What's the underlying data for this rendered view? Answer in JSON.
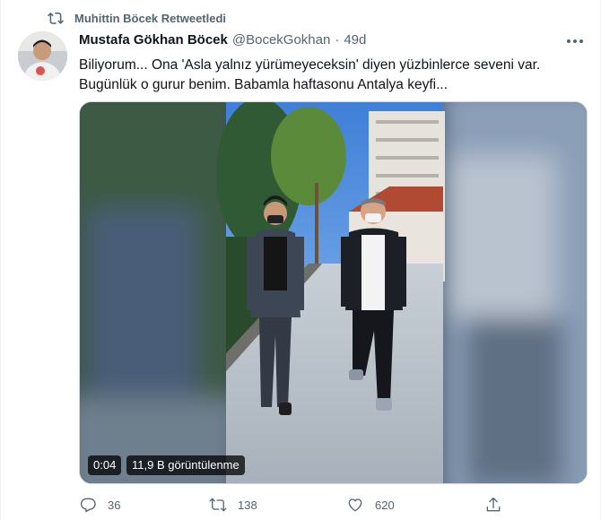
{
  "retweet": {
    "label": "Muhittin Böcek Retweetledi",
    "icon": "retweet-icon"
  },
  "author": {
    "name": "Mustafa Gökhan Böcek",
    "handle": "@BocekGokhan",
    "separator": "·",
    "time": "49d"
  },
  "tweet": {
    "line1": "Biliyorum... Ona 'Asla yalnız yürümeyeceksin' diyen yüzbinlerce seveni var.",
    "line2": "Bugünlük o gurur benim. Babamla haftasonu Antalya keyfi..."
  },
  "video": {
    "duration": "0:04",
    "views": "11,9 B görüntülenme"
  },
  "actions": {
    "reply": {
      "icon": "reply-icon",
      "count": "36"
    },
    "retweet": {
      "icon": "retweet-icon",
      "count": "138"
    },
    "like": {
      "icon": "heart-icon",
      "count": "620"
    },
    "share": {
      "icon": "share-icon",
      "count": ""
    }
  },
  "colors": {
    "muted": "#536471",
    "text": "#0f1419",
    "border": "#cfd9de"
  }
}
